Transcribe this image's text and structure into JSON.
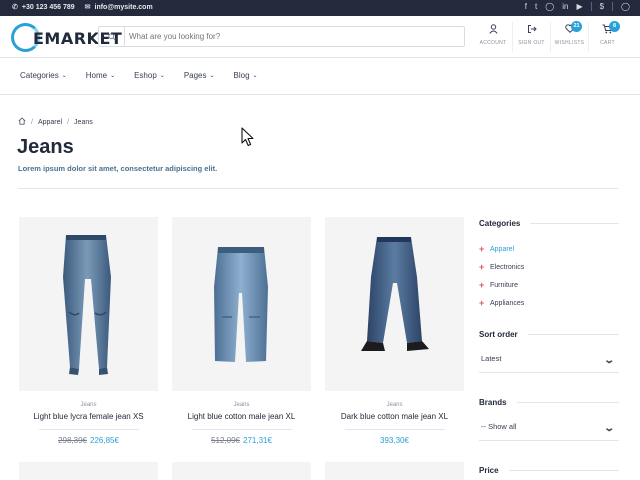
{
  "topbar": {
    "phone": "+30 123 456 789",
    "email": "info@mysite.com",
    "socials": [
      "facebook-icon",
      "twitter-icon",
      "instagram-icon",
      "linkedin-icon",
      "youtube-icon",
      "dollar-icon",
      "globe-icon"
    ]
  },
  "header": {
    "logo_text": "EMARKET",
    "search_placeholder": "What are you looking for?",
    "actions": [
      {
        "label": "ACCOUNT",
        "icon": "user-icon",
        "badge": ""
      },
      {
        "label": "SIGN OUT",
        "icon": "sign-out-icon",
        "badge": ""
      },
      {
        "label": "WISHLISTS",
        "icon": "heart-icon",
        "badge": "21"
      },
      {
        "label": "CART",
        "icon": "cart-icon",
        "badge": "8"
      }
    ]
  },
  "nav": {
    "items": [
      "Categories",
      "Home",
      "Eshop",
      "Pages",
      "Blog"
    ]
  },
  "breadcrumb": {
    "items": [
      "Apparel",
      "Jeans"
    ]
  },
  "page": {
    "title": "Jeans",
    "subtitle": "Lorem ipsum dolor sit amet, consectetur adipiscing elit."
  },
  "products": [
    {
      "category": "Jeans",
      "name": "Light blue lycra female jean XS",
      "old_price": "298,39€",
      "price": "226,85€"
    },
    {
      "category": "Jeans",
      "name": "Light blue cotton male jean XL",
      "old_price": "512,09€",
      "price": "271,31€"
    },
    {
      "category": "Jeans",
      "name": "Dark blue cotton male jean XL",
      "old_price": "",
      "price": "393,30€"
    }
  ],
  "sidebar": {
    "categories_title": "Categories",
    "categories": [
      {
        "label": "Apparel",
        "active": true
      },
      {
        "label": "Electronics",
        "active": false
      },
      {
        "label": "Furniture",
        "active": false
      },
      {
        "label": "Appliances",
        "active": false
      }
    ],
    "sort_title": "Sort order",
    "sort_value": "Latest",
    "brands_title": "Brands",
    "brands_value": "-- Show all",
    "price_title": "Price"
  },
  "colors": {
    "accent": "#2aa0d8",
    "dark": "#232a3b",
    "plus": "#e0566c"
  }
}
